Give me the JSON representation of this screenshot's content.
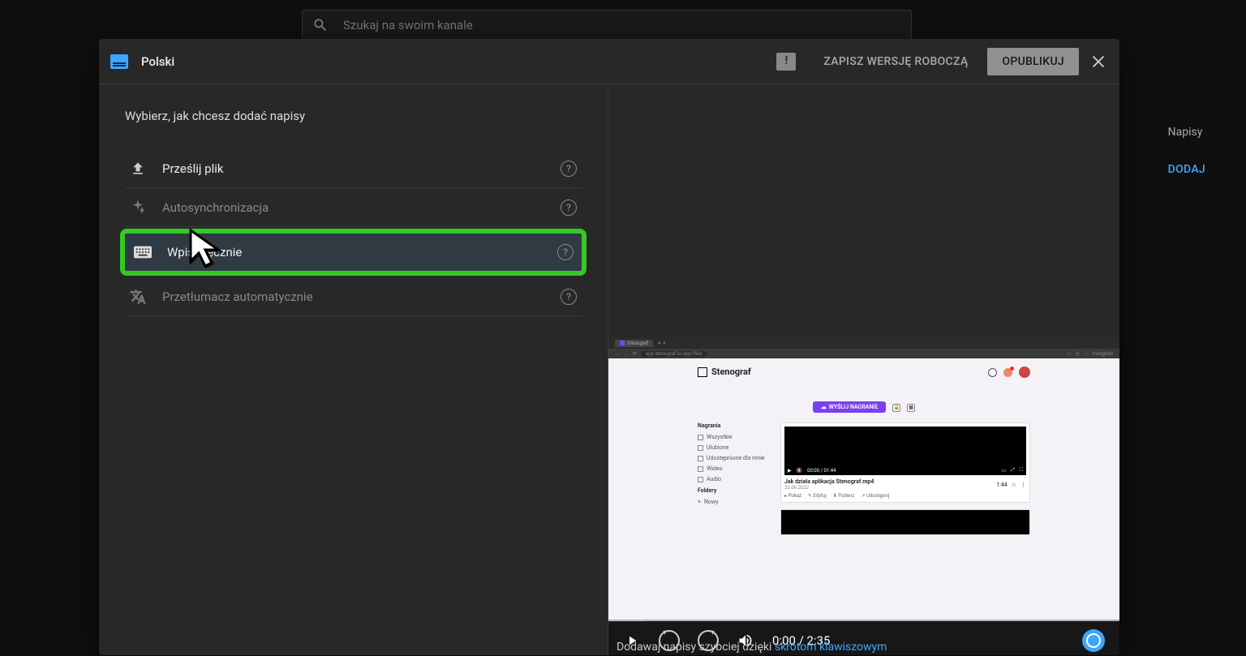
{
  "background": {
    "search_placeholder": "Szukaj na swoim kanale",
    "right_column_header": "Napisy",
    "right_add": "DODAJ"
  },
  "modal": {
    "language": "Polski",
    "save_draft_label": "ZAPISZ WERSJĘ ROBOCZĄ",
    "publish_label": "OPUBLIKUJ",
    "prompt": "Wybierz, jak chcesz dodać napisy",
    "options": [
      {
        "id": "upload",
        "label": "Prześlij plik"
      },
      {
        "id": "autosync",
        "label": "Autosynchronizacja"
      },
      {
        "id": "manual",
        "label": "Wpisz ręcznie"
      },
      {
        "id": "autotranslate",
        "label": "Przetłumacz automatycznie"
      }
    ],
    "bottom_hint_prefix": "Dodawaj napisy szybciej dzięki ",
    "bottom_hint_link": "skrótom klawiszowym"
  },
  "player": {
    "time_display": "0:00 / 2:35"
  },
  "thumbnail": {
    "tab_title": "Stenograf",
    "url": "app.stenograf.io/app/files",
    "incognito": "Incognito",
    "brand": "Stenograf",
    "send_button": "WYŚLIJ NAGRANIE",
    "sidebar": {
      "section1": "Nagrania",
      "items1": [
        "Wszystkie",
        "Ulubione",
        "Udostępnione dla mnie",
        "Wideo",
        "Audio"
      ],
      "section2": "Foldery",
      "items2": [
        "Nowy"
      ]
    },
    "card": {
      "inner_time": "00:00 / 01:44",
      "title": "Jak działa aplikacja Stenograf.mp4",
      "date": "20.06.2022",
      "duration": "1:44",
      "actions": [
        "Pokaż",
        "Edytuj",
        "Pobierz",
        "Udostępnij"
      ]
    }
  }
}
